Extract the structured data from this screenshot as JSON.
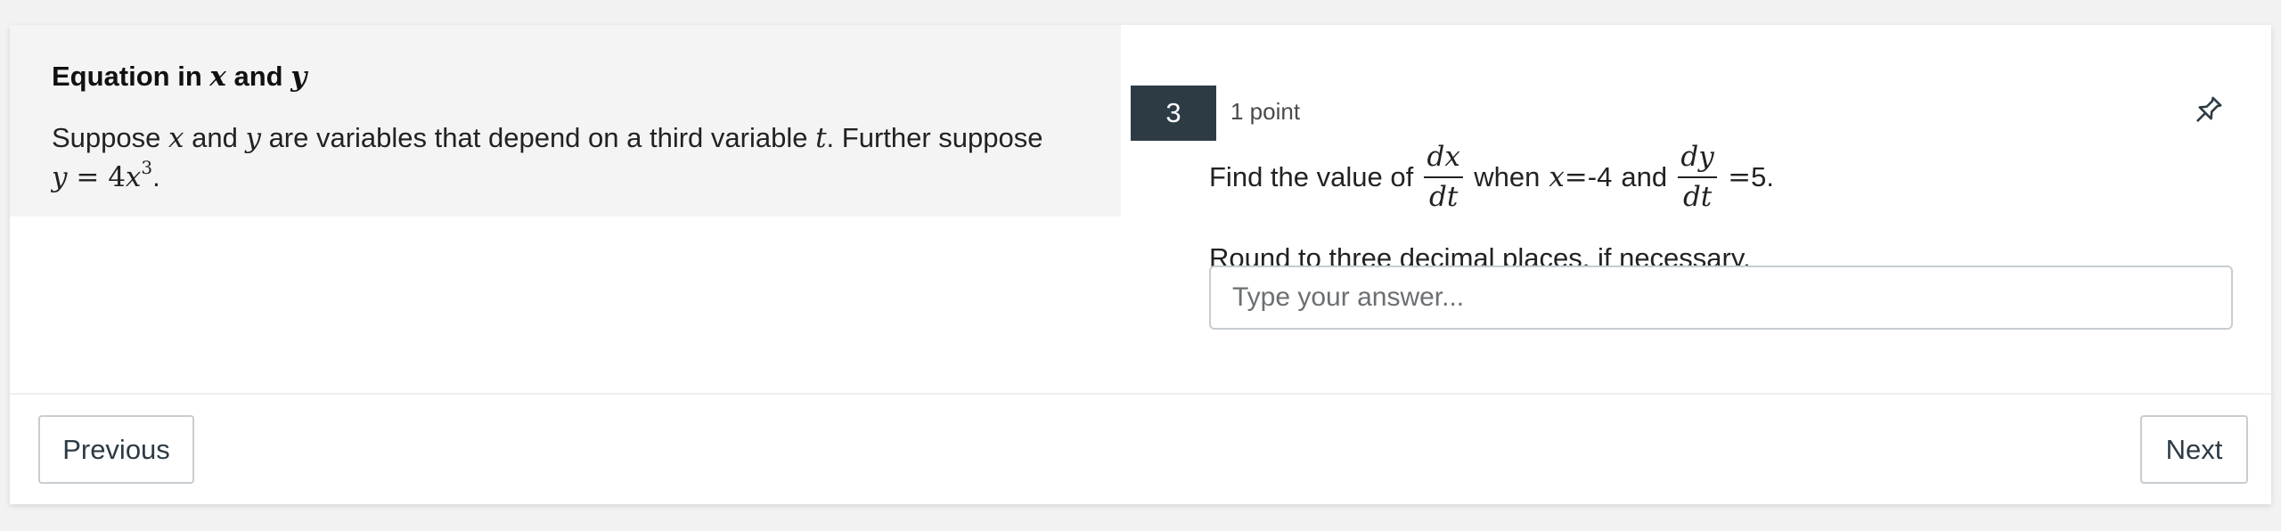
{
  "stimulus": {
    "title_prefix": "Equation in ",
    "title_var_x": "x",
    "title_and": " and ",
    "title_var_y": "y",
    "body_1": "Suppose ",
    "body_var_x": "x",
    "body_2": " and  ",
    "body_var_y": "y",
    "body_3": " are variables that depend on a third variable ",
    "body_var_t": "t",
    "body_4": ". Further suppose",
    "eq_y": "y",
    "eq_equals": " = 4",
    "eq_x": "x",
    "eq_exp": "3",
    "eq_period": "."
  },
  "question": {
    "number": "3",
    "points": "1 point",
    "pin_icon": "pin-icon",
    "text_1": "Find the value of",
    "frac1_num": "dx",
    "frac1_den": "dt",
    "text_2": "when",
    "var_x": "x",
    "eq1": " =",
    "value_x": "-4",
    "text_3": "and",
    "frac2_num": "dy",
    "frac2_den": "dt",
    "eq2": "=",
    "value_dydt": "5",
    "text_4": ".",
    "instruction": "Round to three decimal places, if necessary.",
    "answer_placeholder": "Type your answer...",
    "answer_value": ""
  },
  "navigation": {
    "previous_label": "Previous",
    "next_label": "Next"
  },
  "colors": {
    "question_number_bg": "#2d3b45",
    "stimulus_bg": "#f4f4f4",
    "border": "#c7cdd1"
  }
}
